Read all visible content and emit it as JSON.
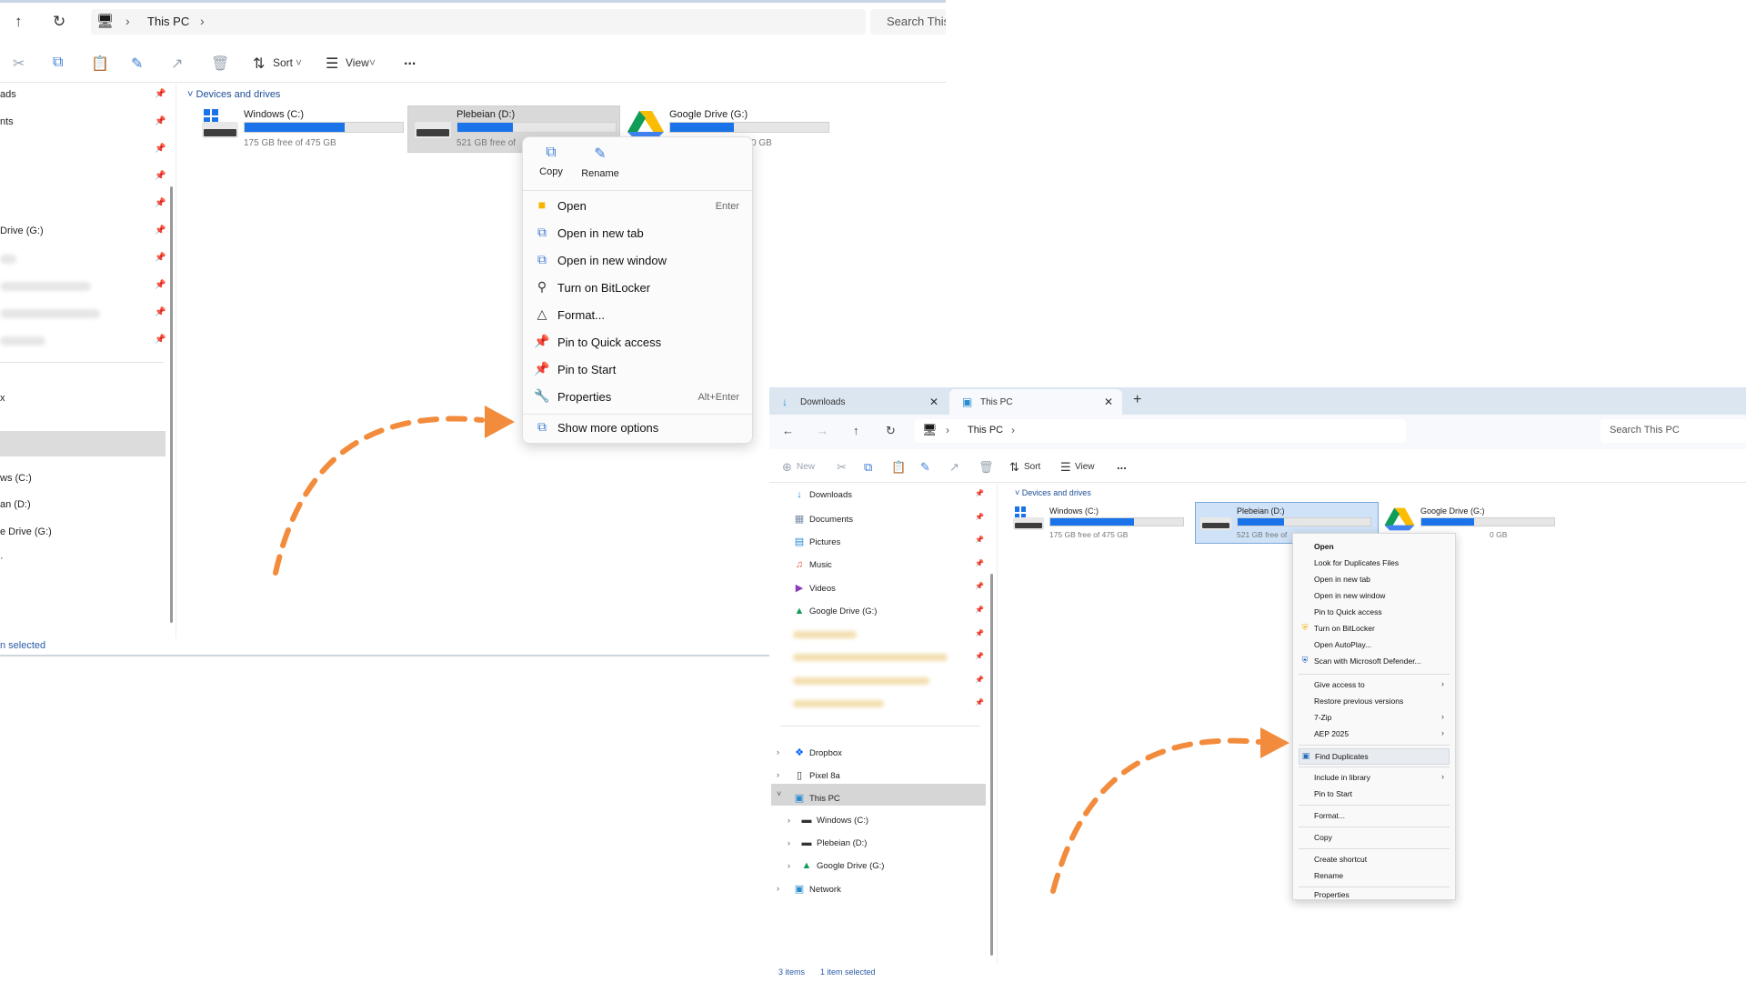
{
  "left": {
    "address": {
      "crumb": "This PC"
    },
    "search": {
      "placeholder": "Search This"
    },
    "toolbar": {
      "sort_label": "Sort",
      "view_label": "View",
      "more_label": "..."
    },
    "sidebar": {
      "items": [
        "ads",
        "nts",
        "Drive (G:)",
        "ws (C:)",
        "an (D:)",
        "e Drive (G:)"
      ],
      "partial_x": "x"
    },
    "section_title": "Devices and drives",
    "drives": [
      {
        "name": "Windows (C:)",
        "free": "175 GB free of 475 GB",
        "used_fraction": 0.63
      },
      {
        "name": "Plebeian (D:)",
        "free": "521 GB free of",
        "used_fraction": 0.35
      },
      {
        "name": "Google Drive (G:)",
        "free": "0 GB",
        "used_fraction": 0.4
      }
    ],
    "context_menu": {
      "quick_actions": [
        {
          "label": "Copy"
        },
        {
          "label": "Rename"
        }
      ],
      "items": [
        {
          "label": "Open",
          "shortcut": "Enter"
        },
        {
          "label": "Open in new tab",
          "shortcut": ""
        },
        {
          "label": "Open in new window",
          "shortcut": ""
        },
        {
          "label": "Turn on BitLocker",
          "shortcut": ""
        },
        {
          "label": "Format...",
          "shortcut": ""
        },
        {
          "label": "Pin to Quick access",
          "shortcut": ""
        },
        {
          "label": "Pin to Start",
          "shortcut": ""
        },
        {
          "label": "Properties",
          "shortcut": "Alt+Enter"
        }
      ],
      "more": "Show more options"
    },
    "status": "n selected"
  },
  "right": {
    "tabs": [
      {
        "label": "Downloads"
      },
      {
        "label": "This PC"
      }
    ],
    "address": {
      "crumb": "This PC"
    },
    "search": {
      "placeholder": "Search This PC"
    },
    "toolbar": {
      "new_label": "New",
      "sort_label": "Sort",
      "view_label": "View",
      "more_label": "..."
    },
    "sidebar": {
      "pinned": [
        "Downloads",
        "Documents",
        "Pictures",
        "Music",
        "Videos",
        "Google Drive (G:)"
      ],
      "roots": [
        "Dropbox",
        "Pixel 8a",
        "This PC"
      ],
      "children": [
        "Windows (C:)",
        "Plebeian (D:)",
        "Google Drive (G:)"
      ],
      "network": "Network"
    },
    "section_title": "Devices and drives",
    "drives": [
      {
        "name": "Windows (C:)",
        "free": "175 GB free of 475 GB",
        "used_fraction": 0.63
      },
      {
        "name": "Plebeian (D:)",
        "free": "521 GB free of",
        "used_fraction": 0.35
      },
      {
        "name": "Google Drive (G:)",
        "free": "0 GB",
        "used_fraction": 0.4
      }
    ],
    "context_menu": {
      "group1": [
        "Open",
        "Look for Duplicates Files",
        "Open in new tab",
        "Open in new window",
        "Pin to Quick access",
        "Turn on BitLocker",
        "Open AutoPlay...",
        "Scan with Microsoft Defender..."
      ],
      "group2": [
        "Give access to",
        "Restore previous versions",
        "7-Zip",
        "AEP 2025"
      ],
      "highlight": "Find Duplicates",
      "group3": [
        "Include in library",
        "Pin to Start"
      ],
      "format": "Format...",
      "copy": "Copy",
      "group4": [
        "Create shortcut",
        "Rename"
      ],
      "properties": "Properties"
    },
    "status": {
      "items": "3 items",
      "selected": "1 item selected"
    }
  },
  "colors": {
    "arrow": "#f28c3c",
    "accent": "#1a73e8",
    "selection": "#cfe2f7"
  }
}
